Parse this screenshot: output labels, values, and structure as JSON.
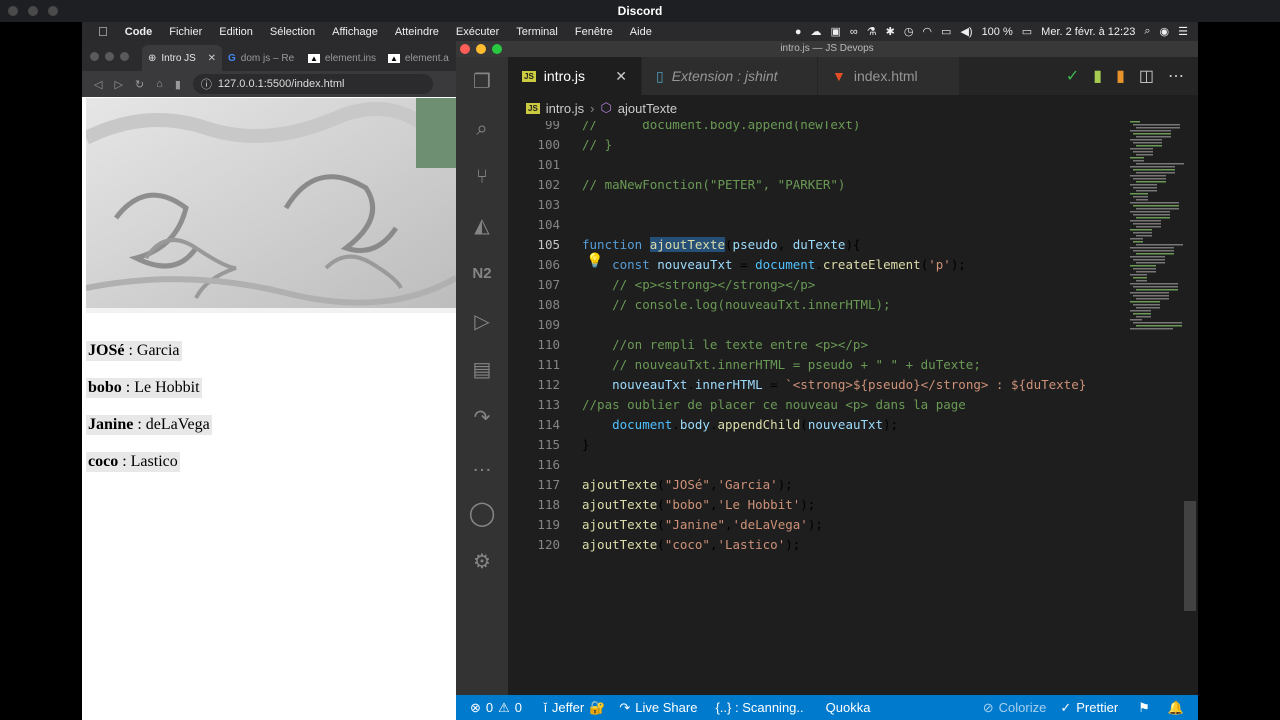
{
  "discord": {
    "title": "Discord"
  },
  "menubar": {
    "items": [
      "Code",
      "Fichier",
      "Edition",
      "Sélection",
      "Affichage",
      "Atteindre",
      "Exécuter",
      "Terminal",
      "Fenêtre",
      "Aide"
    ],
    "battery": "100 %",
    "datetime": "Mer. 2 févr. à 12:23"
  },
  "browser": {
    "tabs": [
      {
        "label": "Intro JS"
      },
      {
        "label": "dom js – Re"
      },
      {
        "label": "element.ins"
      },
      {
        "label": "element.a"
      }
    ],
    "url": "127.0.0.1:5500/index.html",
    "entries": [
      {
        "name": "JOSé",
        "rest": " : Garcia"
      },
      {
        "name": "bobo",
        "rest": " : Le Hobbit"
      },
      {
        "name": "Janine",
        "rest": " : deLaVega"
      },
      {
        "name": "coco",
        "rest": " : Lastico"
      }
    ]
  },
  "vscode": {
    "window_title": "intro.js — JS Devops",
    "tabs": [
      {
        "label": "intro.js",
        "icon": "js-file-icon"
      },
      {
        "label": "Extension : jshint",
        "icon": "file-doc-icon"
      },
      {
        "label": "index.html",
        "icon": "html5-icon"
      }
    ],
    "breadcrumb": {
      "file": "intro.js",
      "symbol": "ajoutTexte"
    },
    "lines": [
      {
        "n": "99",
        "text": "//      document.body.append(newText)"
      },
      {
        "n": "100",
        "text": "// }"
      },
      {
        "n": "101",
        "text": ""
      },
      {
        "n": "102",
        "text": "// maNewFonction(\"PETER\", \"PARKER\")"
      },
      {
        "n": "103",
        "text": ""
      },
      {
        "n": "104",
        "text": ""
      },
      {
        "n": "105",
        "text": "function ajoutTexte(pseudo, duTexte){"
      },
      {
        "n": "106",
        "text": "    const nouveauTxt = document.createElement('p');"
      },
      {
        "n": "107",
        "text": "    // <p><strong></strong></p>"
      },
      {
        "n": "108",
        "text": "    // console.log(nouveauTxt.innerHTML);"
      },
      {
        "n": "109",
        "text": ""
      },
      {
        "n": "110",
        "text": "    //on rempli le texte entre <p></p>"
      },
      {
        "n": "111",
        "text": "    // nouveauTxt.innerHTML = pseudo + \" \" + duTexte;"
      },
      {
        "n": "112",
        "text": "    nouveauTxt.innerHTML = `<strong>${pseudo}</strong> : ${duTexte}"
      },
      {
        "n": "113",
        "text": "//pas oublier de placer ce nouveau <p> dans la page"
      },
      {
        "n": "114",
        "text": "    document.body.appendChild(nouveauTxt);"
      },
      {
        "n": "115",
        "text": "}"
      },
      {
        "n": "116",
        "text": ""
      },
      {
        "n": "117",
        "text": "ajoutTexte(\"JOSé\",'Garcia');"
      },
      {
        "n": "118",
        "text": "ajoutTexte(\"bobo\",'Le Hobbit');"
      },
      {
        "n": "119",
        "text": "ajoutTexte(\"Janine\",'deLaVega');"
      },
      {
        "n": "120",
        "text": "ajoutTexte(\"coco\",'Lastico');"
      }
    ],
    "status": {
      "errors": "0",
      "warnings": "0",
      "user": "Jeffer",
      "live_share": "Live Share",
      "scanning": "{..} : Scanning..",
      "quokka": "Quokka",
      "colorize": "Colorize",
      "prettier": "Prettier"
    }
  },
  "colors": {
    "accent": "#007acc",
    "editor_bg": "#1e1e1e",
    "activity_bg": "#333333"
  }
}
